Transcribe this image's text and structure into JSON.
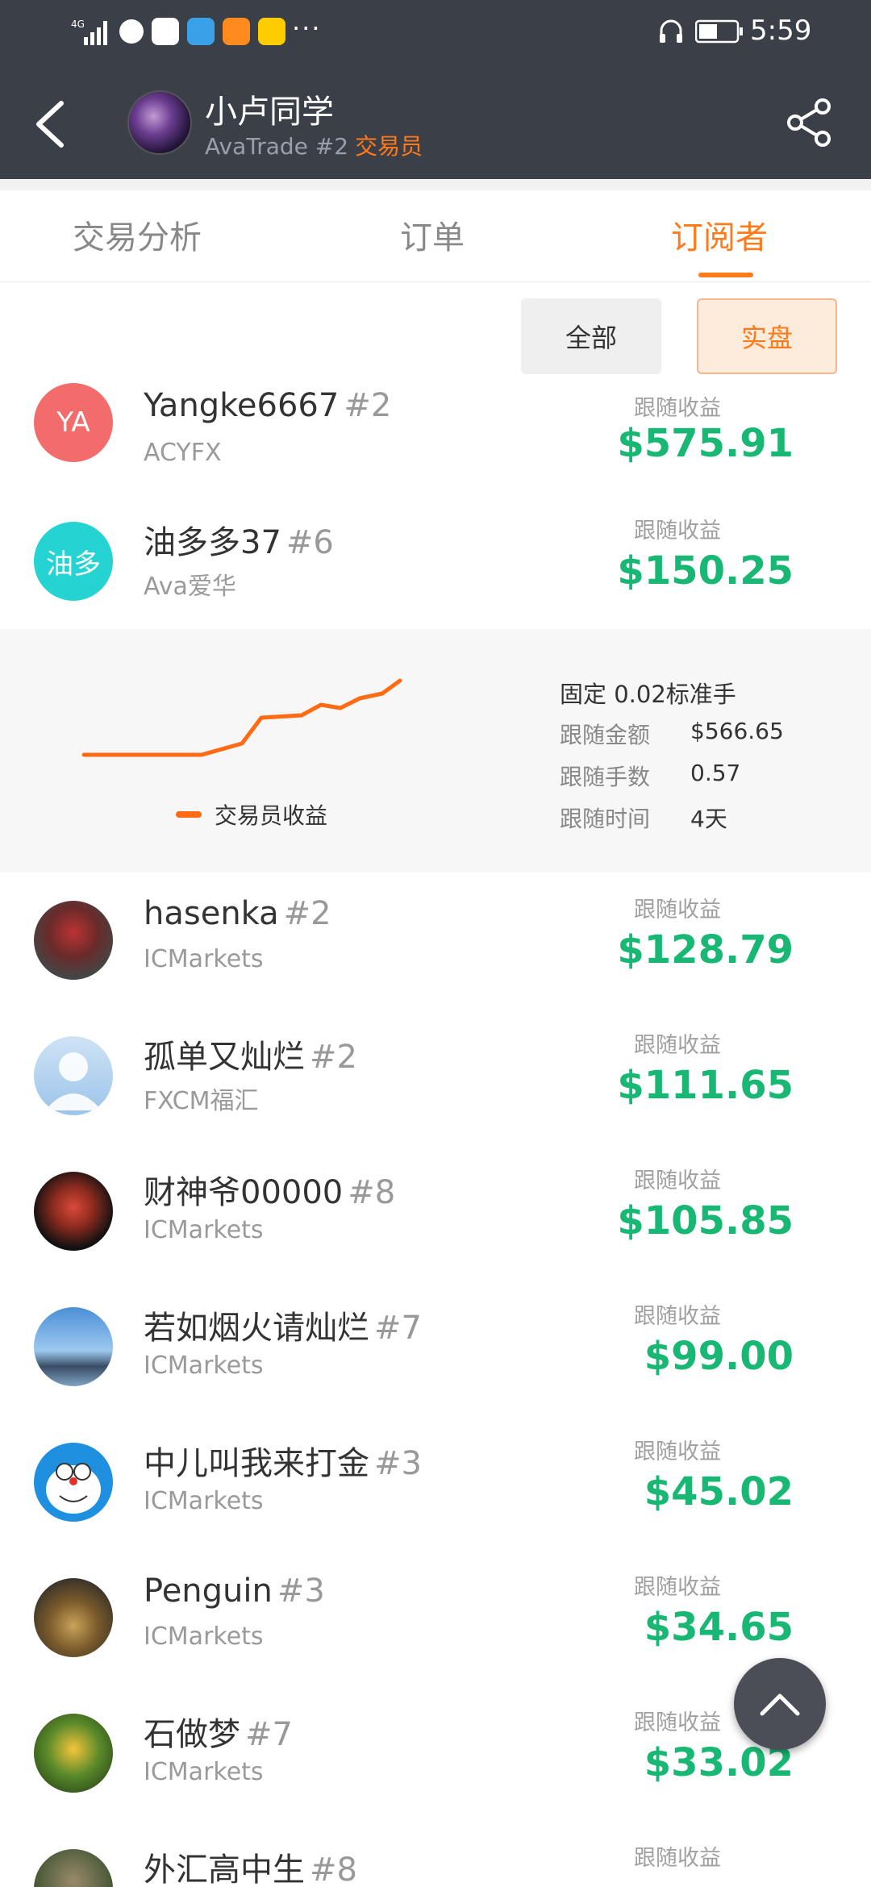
{
  "status": {
    "network": "4G",
    "time": "5:59"
  },
  "header": {
    "trader_name": "小卢同学",
    "trader_broker": "AvaTrade #2",
    "trader_role": "交易员"
  },
  "tabs": [
    {
      "label": "交易分析"
    },
    {
      "label": "订单"
    },
    {
      "label": "订阅者",
      "active": true
    }
  ],
  "filters": {
    "all_label": "全部",
    "real_label": "实盘",
    "selected": "实盘"
  },
  "profit_label": "跟随收益",
  "subscribers": [
    {
      "avatar_text": "YA",
      "name": "Yangke6667",
      "rank": "#2",
      "broker": "ACYFX",
      "profit": "$575.91",
      "avatar_color": "#f26c6c"
    },
    {
      "avatar_text": "油多",
      "name": "油多多37",
      "rank": "#6",
      "broker": "Ava爱华",
      "profit": "$150.25",
      "avatar_color": "#25d3d3"
    },
    {
      "name": "hasenka",
      "rank": "#2",
      "broker": "ICMarkets",
      "profit": "$128.79"
    },
    {
      "name": "孤单又灿烂",
      "rank": "#2",
      "broker": "FXCM福汇",
      "profit": "$111.65"
    },
    {
      "name": "财神爷00000",
      "rank": "#8",
      "broker": "ICMarkets",
      "profit": "$105.85"
    },
    {
      "name": "若如烟火请灿烂",
      "rank": "#7",
      "broker": "ICMarkets",
      "profit": "$99.00"
    },
    {
      "name": "中儿叫我来打金",
      "rank": "#3",
      "broker": "ICMarkets",
      "profit": "$45.02"
    },
    {
      "name": "Penguin",
      "rank": "#3",
      "broker": "ICMarkets",
      "profit": "$34.65"
    },
    {
      "name": "石做梦",
      "rank": "#7",
      "broker": "ICMarkets",
      "profit": "$33.02"
    },
    {
      "name": "外汇高中生",
      "rank": "#8",
      "broker": "",
      "profit": ""
    }
  ],
  "detail": {
    "mode": "固定 0.02标准手",
    "amount_label": "跟随金额",
    "amount": "$566.65",
    "lots_label": "跟随手数",
    "lots": "0.57",
    "duration_label": "跟随时间",
    "duration": "4天",
    "legend": "交易员收益",
    "line_color": "#ff6a13",
    "profit_color": "#19b774",
    "accent_color": "#ff7a1a"
  }
}
